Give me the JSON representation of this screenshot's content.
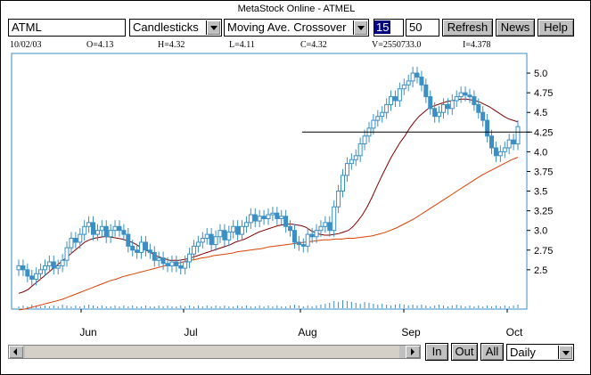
{
  "window": {
    "title": "MetaStock Online - ATMEL"
  },
  "toolbar": {
    "symbol": "ATML",
    "chart_type": "Candlesticks",
    "indicator": "Moving Ave. Crossover",
    "param1": "15",
    "param2": "50",
    "refresh_label": "Refresh",
    "news_label": "News",
    "help_label": "Help"
  },
  "info": {
    "date": "10/02/03",
    "open": "O=4.13",
    "high": "H=4.32",
    "low": "L=4.11",
    "close": "C=4.32",
    "volume": "V=2550733.0",
    "indicator": "I=4.378"
  },
  "bottom": {
    "in_label": "In",
    "out_label": "Out",
    "all_label": "All",
    "period": "Daily"
  },
  "chart_data": {
    "type": "candlestick",
    "x_labels": [
      "Jun",
      "Jul",
      "Aug",
      "Sep",
      "Oct"
    ],
    "y_ticks": [
      "5.0",
      "4.75",
      "4.5",
      "4.25",
      "4.0",
      "3.75",
      "3.5",
      "3.25",
      "3.0",
      "2.75",
      "2.5"
    ],
    "ylim": [
      2.0,
      5.25
    ],
    "horizontal_line": 4.25,
    "colors": {
      "up": "#3a8fc4",
      "fast_ma": "#800000",
      "slow_ma": "#e04000",
      "frame": "#3a8fc4",
      "volume": "#3a8fc4"
    },
    "closes": [
      2.55,
      2.5,
      2.42,
      2.38,
      2.45,
      2.5,
      2.55,
      2.6,
      2.52,
      2.55,
      2.62,
      2.78,
      2.9,
      2.85,
      2.95,
      3.05,
      3.1,
      2.95,
      3.0,
      3.05,
      2.92,
      3.0,
      3.05,
      3.0,
      2.95,
      2.8,
      2.75,
      2.72,
      2.85,
      2.75,
      2.72,
      2.62,
      2.65,
      2.58,
      2.55,
      2.6,
      2.55,
      2.52,
      2.6,
      2.7,
      2.8,
      2.85,
      2.9,
      2.95,
      2.82,
      2.92,
      3.0,
      2.88,
      2.98,
      3.05,
      2.95,
      3.05,
      3.1,
      3.2,
      3.12,
      3.18,
      3.15,
      3.2,
      3.22,
      3.15,
      3.18,
      3.05,
      3.0,
      2.85,
      2.82,
      2.8,
      2.95,
      2.92,
      3.0,
      3.05,
      3.1,
      3.0,
      3.3,
      3.5,
      3.7,
      3.85,
      3.9,
      3.95,
      4.1,
      4.2,
      4.3,
      4.4,
      4.45,
      4.5,
      4.6,
      4.7,
      4.65,
      4.8,
      4.85,
      4.9,
      5.0,
      4.95,
      4.85,
      4.7,
      4.55,
      4.45,
      4.5,
      4.6,
      4.55,
      4.65,
      4.7,
      4.75,
      4.72,
      4.7,
      4.6,
      4.5,
      4.4,
      4.2,
      4.05,
      3.95,
      4.0,
      4.05,
      4.15,
      4.1,
      4.32
    ],
    "fast_ma": [
      2.2,
      2.22,
      2.25,
      2.3,
      2.35,
      2.4,
      2.45,
      2.5,
      2.55,
      2.6,
      2.65,
      2.7,
      2.75,
      2.8,
      2.85,
      2.88,
      2.9,
      2.91,
      2.92,
      2.92,
      2.91,
      2.9,
      2.89,
      2.87,
      2.85,
      2.82,
      2.78,
      2.75,
      2.72,
      2.68,
      2.66,
      2.64,
      2.62,
      2.62,
      2.62,
      2.63,
      2.64,
      2.66,
      2.68,
      2.7,
      2.72,
      2.74,
      2.76,
      2.78,
      2.8,
      2.82,
      2.85,
      2.87,
      2.89,
      2.92,
      2.95,
      2.98,
      3.0,
      3.02,
      3.04,
      3.06,
      3.07,
      3.08,
      3.08,
      3.07,
      3.06,
      3.04,
      3.0,
      2.97,
      2.95,
      2.94,
      2.94,
      2.95,
      2.96,
      2.98,
      3.0,
      3.05,
      3.12,
      3.2,
      3.3,
      3.42,
      3.55,
      3.68,
      3.8,
      3.92,
      4.02,
      4.12,
      4.2,
      4.3,
      4.38,
      4.45,
      4.5,
      4.55,
      4.58,
      4.6,
      4.62,
      4.64,
      4.65,
      4.66,
      4.67,
      4.67,
      4.66,
      4.65,
      4.63,
      4.6,
      4.57,
      4.53,
      4.49,
      4.45,
      4.42,
      4.4,
      4.38
    ],
    "slow_ma": [
      1.99,
      2.0,
      2.02,
      2.04,
      2.06,
      2.08,
      2.1,
      2.12,
      2.15,
      2.18,
      2.21,
      2.24,
      2.27,
      2.3,
      2.33,
      2.36,
      2.38,
      2.41,
      2.43,
      2.45,
      2.47,
      2.49,
      2.51,
      2.53,
      2.55,
      2.56,
      2.58,
      2.6,
      2.62,
      2.63,
      2.65,
      2.66,
      2.68,
      2.69,
      2.7,
      2.71,
      2.73,
      2.74,
      2.75,
      2.76,
      2.77,
      2.79,
      2.8,
      2.81,
      2.82,
      2.83,
      2.84,
      2.85,
      2.86,
      2.87,
      2.88,
      2.88,
      2.89,
      2.89,
      2.9,
      2.9,
      2.91,
      2.92,
      2.93,
      2.95,
      2.97,
      3.0,
      3.03,
      3.07,
      3.11,
      3.15,
      3.2,
      3.25,
      3.3,
      3.35,
      3.4,
      3.45,
      3.5,
      3.55,
      3.6,
      3.65,
      3.7,
      3.74,
      3.78,
      3.82,
      3.86,
      3.9,
      3.93
    ],
    "volumes": [
      2,
      3,
      2,
      4,
      3,
      2,
      3,
      2,
      3,
      2,
      4,
      3,
      2,
      3,
      2,
      3,
      4,
      3,
      2,
      3,
      2,
      2,
      3,
      2,
      3,
      2,
      3,
      2,
      2,
      3,
      2,
      2,
      3,
      2,
      3,
      2,
      2,
      3,
      2,
      3,
      2,
      3,
      2,
      3,
      2,
      3,
      2,
      3,
      2,
      2,
      3,
      2,
      3,
      2,
      2,
      3,
      2,
      3,
      2,
      3,
      2,
      2,
      3,
      4,
      3,
      2,
      3,
      2,
      3,
      4,
      5,
      6,
      8,
      7,
      9,
      8,
      7,
      6,
      5,
      7,
      6,
      5,
      4,
      5,
      4,
      3,
      4,
      5,
      4,
      3,
      4,
      3,
      4,
      3,
      2,
      3,
      4,
      3,
      2,
      3,
      4,
      3,
      2,
      3,
      2,
      3,
      2,
      3,
      2,
      3,
      2,
      3,
      2,
      3,
      4
    ]
  }
}
